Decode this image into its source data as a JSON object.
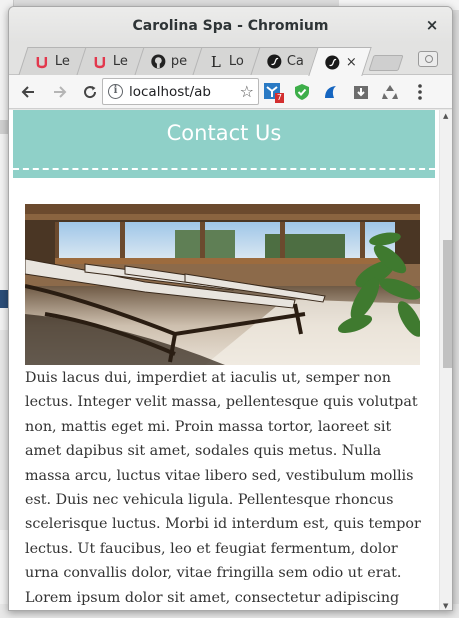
{
  "window": {
    "title": "Carolina Spa - Chromium",
    "close_glyph": "×"
  },
  "tabs": [
    {
      "icon": "udemy-icon",
      "label": "Le",
      "active": false
    },
    {
      "icon": "udemy-icon",
      "label": "Le",
      "active": false
    },
    {
      "icon": "github-icon",
      "label": "pe",
      "active": false
    },
    {
      "icon": "l-letter-icon",
      "label": "Lo",
      "active": false
    },
    {
      "icon": "symfony-icon",
      "label": "Ca",
      "active": false
    },
    {
      "icon": "symfony-icon",
      "label": "",
      "active": true
    }
  ],
  "toolbar": {
    "url": "localhost/ab",
    "extension_badge": "7"
  },
  "page": {
    "heading": "Contact Us",
    "body_text": "Duis lacus dui, imperdiet at iaculis ut, semper non lectus. Integer velit massa, pellentesque quis volutpat non, mattis eget mi. Proin massa tortor, laoreet sit amet dapibus sit amet, sodales quis metus. Nulla massa arcu, luctus vitae libero sed, vestibulum mollis est. Duis nec vehicula ligula. Pellentesque rhoncus scelerisque luctus. Morbi id interdum est, quis tempor lectus. Ut faucibus, leo et feugiat fermentum, dolor urna convallis dolor, vitae fringilla sem odio ut erat. Lorem ipsum dolor sit amet, consectetur adipiscing elit."
  },
  "colors": {
    "header_band": "#8fd0c8",
    "heading_text": "#ffffff"
  }
}
